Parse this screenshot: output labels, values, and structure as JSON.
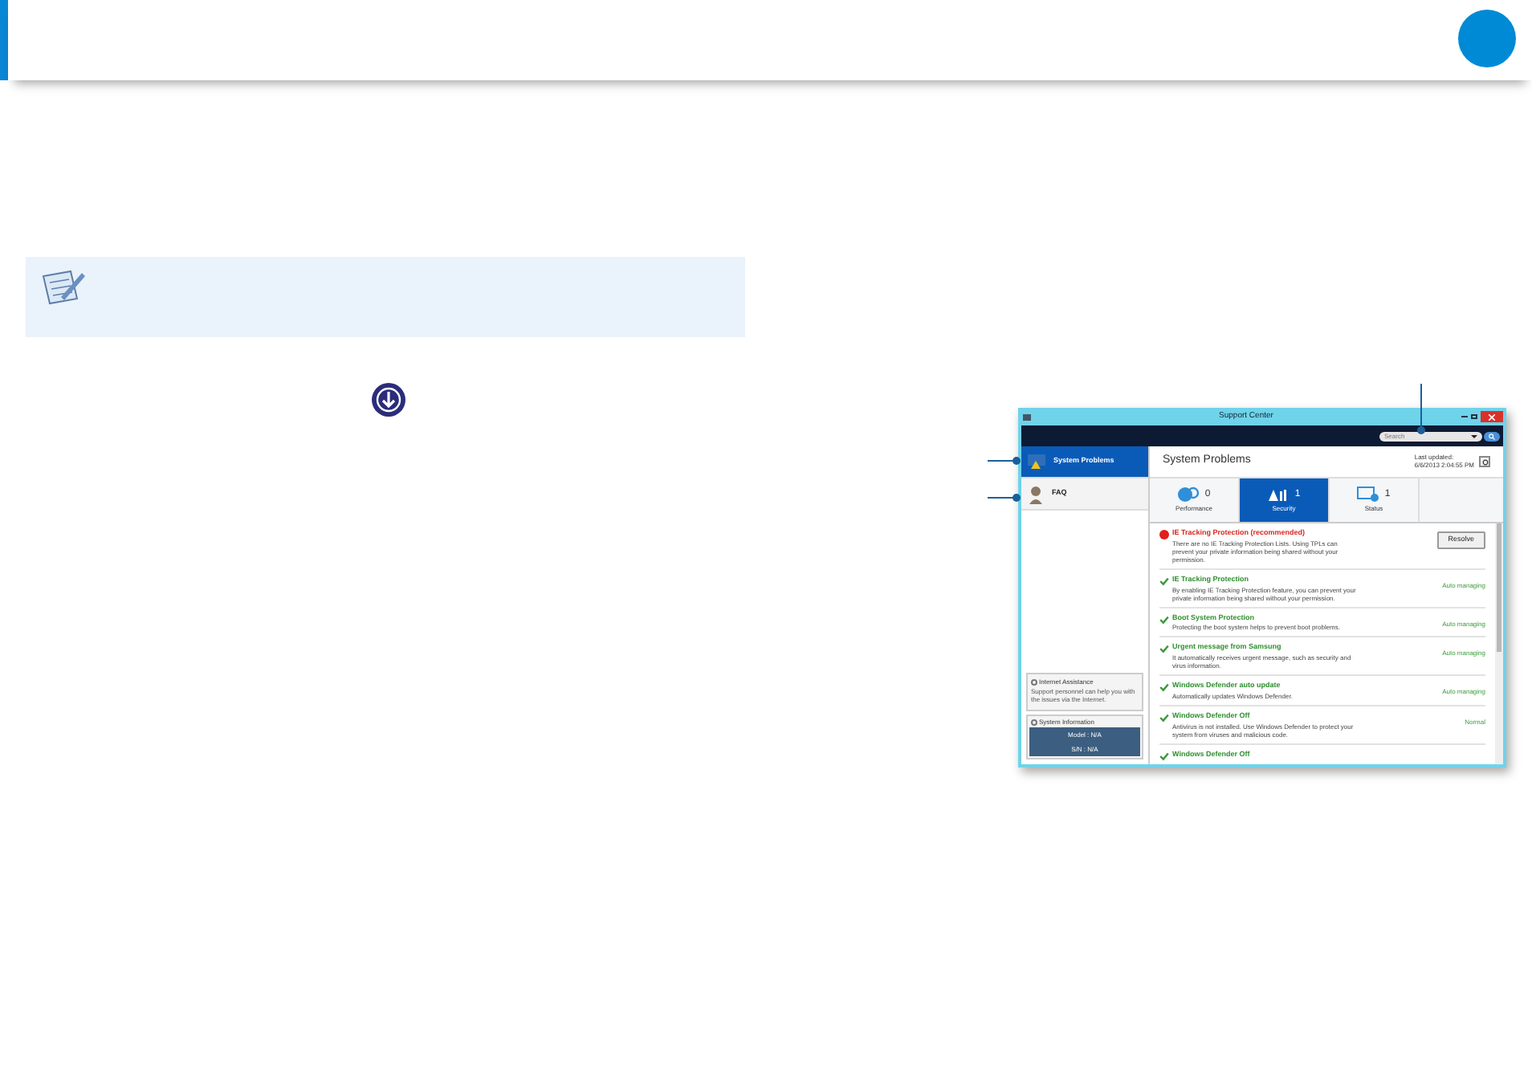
{
  "window": {
    "title": "Support Center"
  },
  "search": {
    "placeholder": "Search"
  },
  "sidebar": {
    "items": [
      {
        "label": "System Problems",
        "selected": true
      },
      {
        "label": "FAQ",
        "selected": false
      }
    ],
    "internet_assistance": {
      "title": "Internet Assistance",
      "text": "Support personnel can help you with the issues via the Internet."
    },
    "system_information": {
      "title": "System Information",
      "model": "Model : N/A",
      "serial": "S/N : N/A"
    }
  },
  "main": {
    "title": "System Problems",
    "last_updated_label": "Last updated:",
    "last_updated": "6/6/2013 2:04:55 PM"
  },
  "tabs": [
    {
      "label": "Performance",
      "count": "0",
      "selected": false
    },
    {
      "label": "Security",
      "count": "1",
      "selected": true
    },
    {
      "label": "Status",
      "count": "1",
      "selected": false
    }
  ],
  "issues": [
    {
      "kind": "error",
      "title": "IE Tracking Protection (recommended)",
      "text": "There are no IE Tracking Protection Lists. Using TPLs can prevent your private information being shared without your permission.",
      "action": "Resolve"
    },
    {
      "kind": "ok",
      "title": "IE Tracking Protection",
      "text": "By enabling IE Tracking Protection feature, you can prevent your private information being shared without your permission.",
      "status": "Auto managing"
    },
    {
      "kind": "ok",
      "title": "Boot System Protection",
      "text": "Protecting the boot system helps to prevent boot problems.",
      "status": "Auto managing"
    },
    {
      "kind": "ok",
      "title": "Urgent message from Samsung",
      "text": "It automatically receives urgent message, such as security and virus information.",
      "status": "Auto managing"
    },
    {
      "kind": "ok",
      "title": "Windows Defender auto update",
      "text": "Automatically updates Windows Defender.",
      "status": "Auto managing"
    },
    {
      "kind": "ok",
      "title": "Windows Defender Off",
      "text": "Antivirus is not installed. Use Windows Defender to protect your system from viruses and malicious code.",
      "status": "Normal"
    },
    {
      "kind": "ok",
      "title": "Windows Defender Off"
    }
  ]
}
